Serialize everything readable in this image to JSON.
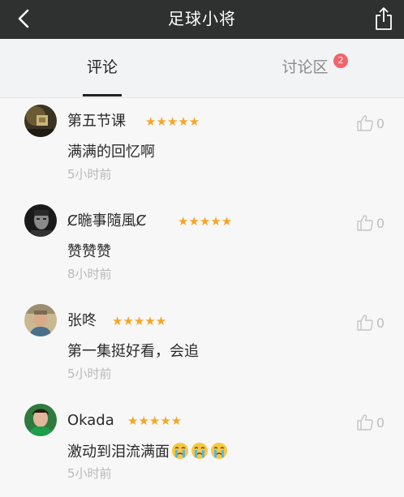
{
  "header": {
    "title": "足球小将"
  },
  "tabs": [
    {
      "label": "评论",
      "active": true
    },
    {
      "label": "讨论区",
      "badge": "2"
    }
  ],
  "comments": [
    {
      "name": "第五节课",
      "stars": "★★★★★",
      "text": "满满的回忆啊",
      "time": "5小时前",
      "likes": "0"
    },
    {
      "name": "Ȼ暆事隨風Ȼ",
      "stars": "★★★★★",
      "text": "赞赞赞",
      "time": "8小时前",
      "likes": "0"
    },
    {
      "name": "张咚",
      "stars": "★★★★★",
      "text": "第一集挺好看，会追",
      "time": "5小时前",
      "likes": "0"
    },
    {
      "name": "Okada",
      "stars": "★★★★★",
      "text": "激动到泪流满面",
      "time": "5小时前",
      "likes": "0"
    }
  ],
  "colors": {
    "topbar": "#2f3030",
    "star": "#f5a623",
    "badge": "#f4636b"
  }
}
